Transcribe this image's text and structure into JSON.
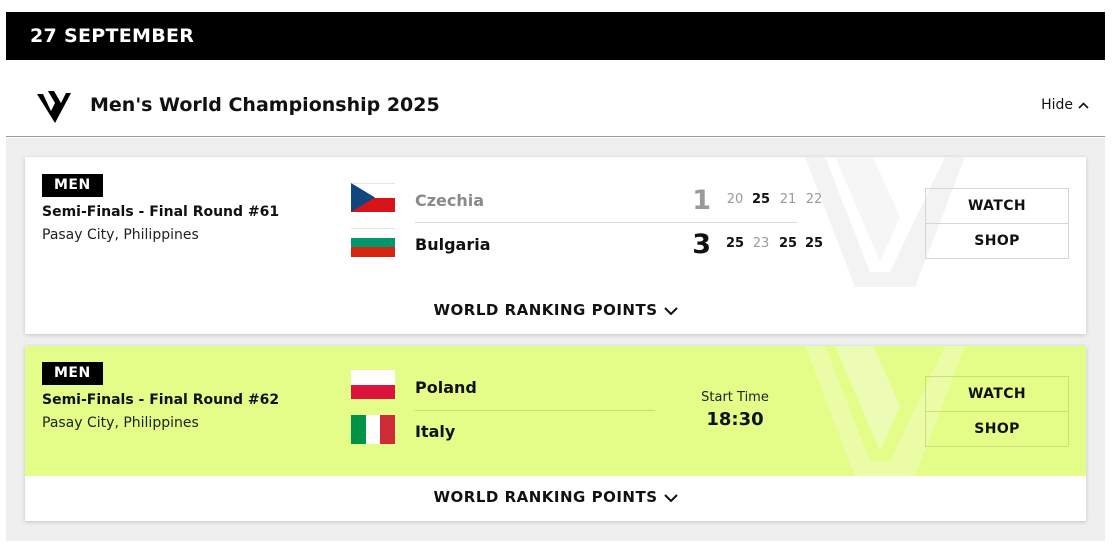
{
  "date": "27 SEPTEMBER",
  "competition": {
    "title": "Men's World Championship 2025",
    "toggle_label": "Hide",
    "logo_icon": "vnl-v-logo-icon"
  },
  "matches": [
    {
      "gender": "MEN",
      "round": "Semi-Finals - Final Round #61",
      "venue": "Pasay City, Philippines",
      "status": "finished",
      "team_a": {
        "name": "Czechia",
        "flag_icon": "czechia-flag-icon",
        "sets_won": "1",
        "sets": [
          "20",
          "25",
          "21",
          "22"
        ]
      },
      "team_b": {
        "name": "Bulgaria",
        "flag_icon": "bulgaria-flag-icon",
        "sets_won": "3",
        "sets": [
          "25",
          "23",
          "25",
          "25"
        ]
      },
      "watch_label": "WATCH",
      "shop_label": "SHOP",
      "ranking_label": "WORLD RANKING POINTS",
      "highlight_color": "#ffffff"
    },
    {
      "gender": "MEN",
      "round": "Semi-Finals - Final Round #62",
      "venue": "Pasay City, Philippines",
      "status": "upcoming",
      "team_a": {
        "name": "Poland",
        "flag_icon": "poland-flag-icon"
      },
      "team_b": {
        "name": "Italy",
        "flag_icon": "italy-flag-icon"
      },
      "start_label": "Start Time",
      "start_time": "18:30",
      "watch_label": "WATCH",
      "shop_label": "SHOP",
      "ranking_label": "WORLD RANKING POINTS",
      "highlight_color": "#e3fd88"
    }
  ],
  "colors": {
    "header_bg": "#000000",
    "highlight": "#e3fd88",
    "muted_text": "#9a9a9a",
    "page_bg": "#efefef"
  }
}
